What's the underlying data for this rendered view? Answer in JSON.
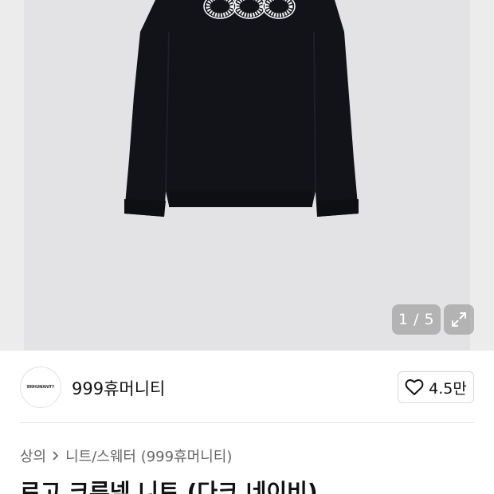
{
  "gallery": {
    "current_page": 1,
    "total_pages": 5,
    "counter_text": "1 / 5"
  },
  "brand": {
    "logo_text": "999HUMANITY",
    "name": "999휴머니티"
  },
  "like": {
    "count": "4.5만"
  },
  "breadcrumb": {
    "category": "상의",
    "subcategory": "니트/스웨터 (999휴머니티)"
  },
  "product": {
    "title": "로고 크루넥 니트 (다크 네이비)"
  },
  "icons": {
    "expand": "expand-icon",
    "heart": "heart-icon",
    "chevron": "chevron-right-icon"
  },
  "colors": {
    "gallery_bg": "#e3e3e5",
    "sweater": "#111318",
    "embroidery": "#f2f2f2"
  }
}
